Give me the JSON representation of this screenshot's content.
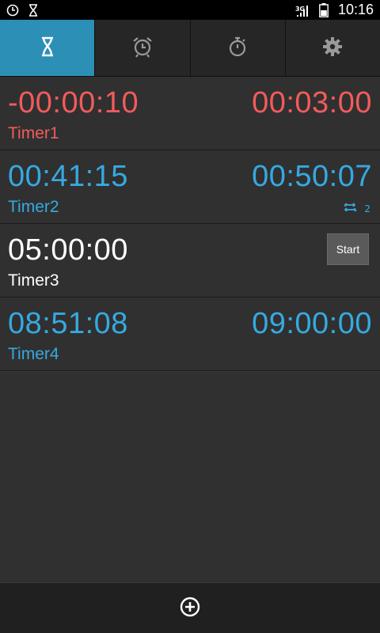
{
  "status_bar": {
    "time": "10:16",
    "network_label": "3G",
    "icons": [
      "clock-icon",
      "hourglass-icon",
      "signal-icon",
      "battery-icon"
    ]
  },
  "tabs": [
    {
      "name": "timers",
      "icon": "hourglass-icon",
      "active": true
    },
    {
      "name": "alarms",
      "icon": "alarm-clock-icon",
      "active": false
    },
    {
      "name": "stopwatch",
      "icon": "stopwatch-icon",
      "active": false
    },
    {
      "name": "settings",
      "icon": "gear-icon",
      "active": false
    }
  ],
  "timers": [
    {
      "elapsed": "-00:00:10",
      "total": "00:03:00",
      "name": "Timer1",
      "state": "overdue",
      "color": "#f25b5b"
    },
    {
      "elapsed": "00:41:15",
      "total": "00:50:07",
      "name": "Timer2",
      "state": "running",
      "color": "#36a9e1",
      "repeat_count": "2"
    },
    {
      "elapsed": "05:00:00",
      "name": "Timer3",
      "state": "stopped",
      "color": "#ffffff",
      "start_label": "Start"
    },
    {
      "elapsed": "08:51:08",
      "total": "09:00:00",
      "name": "Timer4",
      "state": "running",
      "color": "#36a9e1"
    }
  ],
  "bottom_bar": {
    "add_icon": "add-circle-icon"
  },
  "colors": {
    "accent": "#2c8fb6",
    "red": "#f25b5b",
    "blue": "#36a9e1",
    "background": "#303030"
  }
}
